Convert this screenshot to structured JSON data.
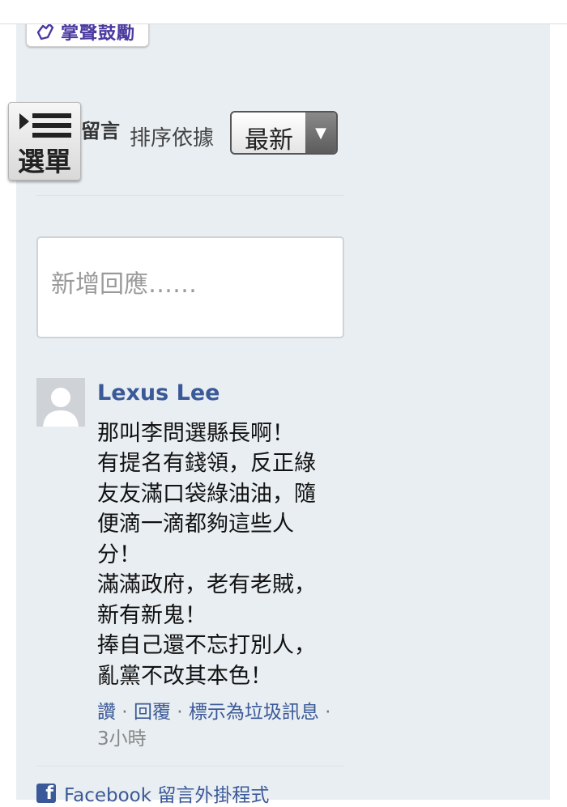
{
  "header": {
    "clap_badge": "掌聲鼓勵"
  },
  "menu_button": {
    "label": "選單"
  },
  "comments": {
    "title": "留言",
    "sort_label": "排序依據",
    "sort_value": "最新",
    "reply_placeholder": "新增回應……"
  },
  "comment": {
    "author": "Lexus Lee",
    "lines": [
      "那叫李問選縣長啊！",
      "有提名有錢領，反正綠",
      "友友滿口袋綠油油，隨",
      "便滴一滴都夠這些人",
      "分！",
      "滿滿政府，老有老賊，",
      "新有新鬼！",
      "捧自己還不忘打別人，",
      "亂黨不改其本色！"
    ],
    "actions": {
      "like": "讚",
      "reply": "回覆",
      "mark_spam": "標示為垃圾訊息",
      "separator": " · "
    },
    "time": "3小時"
  },
  "footer": {
    "label": "Facebook 留言外掛程式"
  },
  "colors": {
    "link": "#3b5998",
    "panel_bg": "#e9eef2",
    "badge_text": "#4b3aa0"
  }
}
